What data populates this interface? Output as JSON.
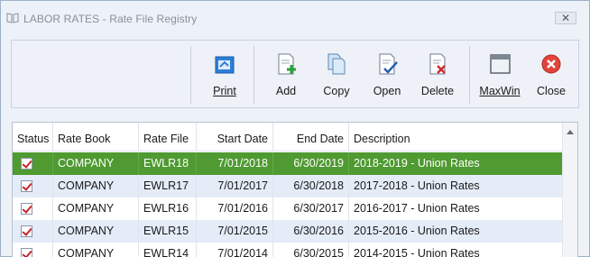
{
  "window": {
    "title": "LABOR RATES - Rate File Registry",
    "close_glyph": "✕"
  },
  "toolbar": {
    "buttons": [
      {
        "id": "print",
        "label": "Print",
        "icon": "print-icon"
      },
      {
        "id": "add",
        "label": "Add",
        "icon": "add-document-icon"
      },
      {
        "id": "copy",
        "label": "Copy",
        "icon": "copy-icon"
      },
      {
        "id": "open",
        "label": "Open",
        "icon": "open-document-icon"
      },
      {
        "id": "delete",
        "label": "Delete",
        "icon": "delete-document-icon"
      },
      {
        "id": "maxwin",
        "label": "MaxWin",
        "icon": "maximize-window-icon"
      },
      {
        "id": "close",
        "label": "Close",
        "icon": "close-circle-icon"
      }
    ]
  },
  "grid": {
    "columns": [
      "Status",
      "Rate Book",
      "Rate File",
      "Start Date",
      "End Date",
      "Description"
    ],
    "rows": [
      {
        "checked": true,
        "rate_book": "COMPANY",
        "rate_file": "EWLR18",
        "start": "7/01/2018",
        "end": "6/30/2019",
        "desc": "2018-2019 - Union Rates",
        "selected": true
      },
      {
        "checked": true,
        "rate_book": "COMPANY",
        "rate_file": "EWLR17",
        "start": "7/01/2017",
        "end": "6/30/2018",
        "desc": "2017-2018 - Union Rates",
        "selected": false
      },
      {
        "checked": true,
        "rate_book": "COMPANY",
        "rate_file": "EWLR16",
        "start": "7/01/2016",
        "end": "6/30/2017",
        "desc": "2016-2017 - Union Rates",
        "selected": false
      },
      {
        "checked": true,
        "rate_book": "COMPANY",
        "rate_file": "EWLR15",
        "start": "7/01/2015",
        "end": "6/30/2016",
        "desc": "2015-2016 - Union Rates",
        "selected": false
      },
      {
        "checked": true,
        "rate_book": "COMPANY",
        "rate_file": "EWLR14",
        "start": "7/01/2014",
        "end": "6/30/2015",
        "desc": "2014-2015 - Union Rates",
        "selected": false
      }
    ]
  },
  "colors": {
    "selected_row": "#4f9a31",
    "alt_row": "#e4ecf8",
    "check_mark": "#c0262d"
  }
}
